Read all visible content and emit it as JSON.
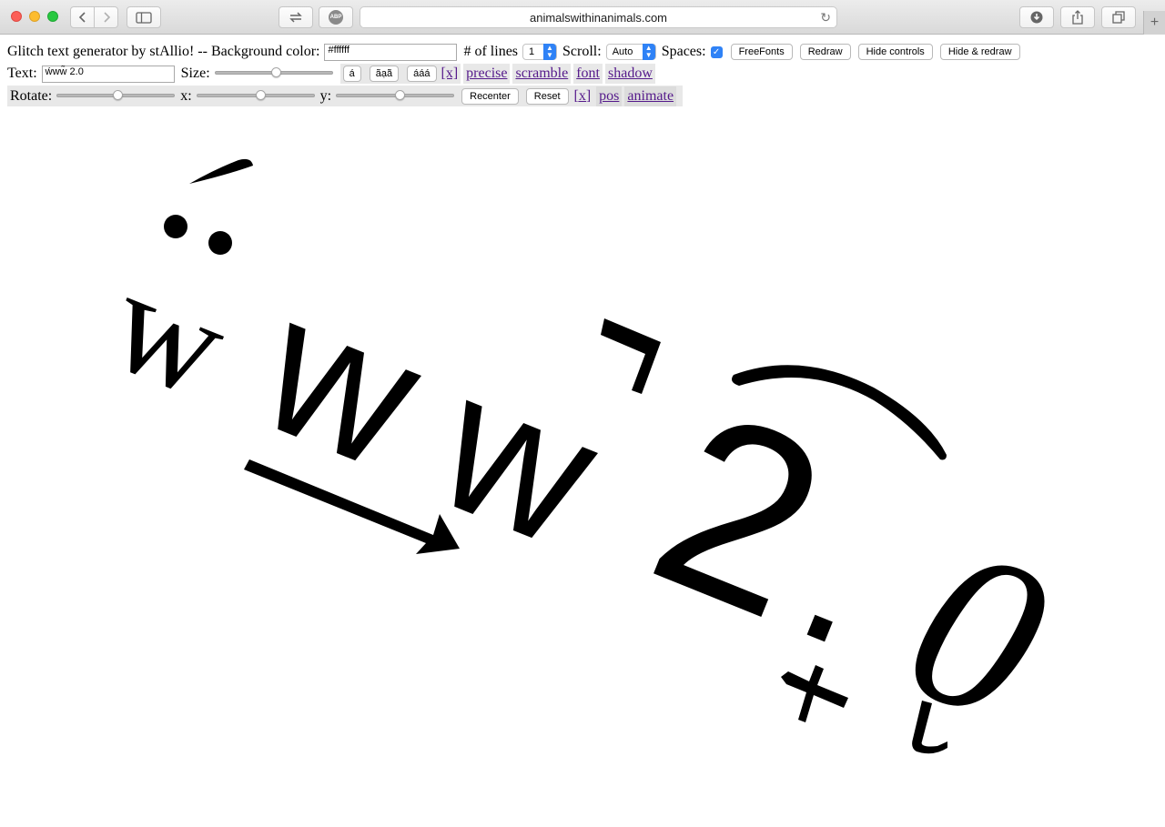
{
  "browser": {
    "url": "animalswithinanimals.com",
    "abp_label": "ABP"
  },
  "controls": {
    "title": "Glitch text generator by stAllio! -- Background color:",
    "bgcolor_value": "#ffffff",
    "lines_label": "# of lines",
    "lines_value": "1",
    "scroll_label": "Scroll:",
    "scroll_value": "Auto",
    "spaces_label": "Spaces:",
    "spaces_checked": true,
    "freefonts_label": "FreeFonts",
    "redraw_label": "Redraw",
    "hide_controls_label": "Hide controls",
    "hide_redraw_label": "Hide & redraw",
    "text_label": "Text:",
    "text_value": "ẃww̃ 2.0",
    "size_label": "Size:",
    "size_level": 0.52,
    "accent_buttons": [
      "á",
      "ãạā̃",
      "ááá"
    ],
    "x_link": "[x]",
    "precise_link": "precise",
    "scramble_link": "scramble",
    "font_link": "font",
    "shadow_link": "shadow",
    "rotate_label": "Rotate:",
    "rotate_level": 0.52,
    "x_label": "x:",
    "x_level": 0.55,
    "y_label": "y:",
    "y_level": 0.55,
    "recenter_label": "Recenter",
    "reset_label": "Reset",
    "x2_link": "[x]",
    "pos_link": "pos",
    "animate_link": "animate"
  },
  "glitch": {
    "chars": [
      "w",
      "w",
      "w",
      "2",
      ".",
      "0"
    ],
    "color": "#000000"
  }
}
